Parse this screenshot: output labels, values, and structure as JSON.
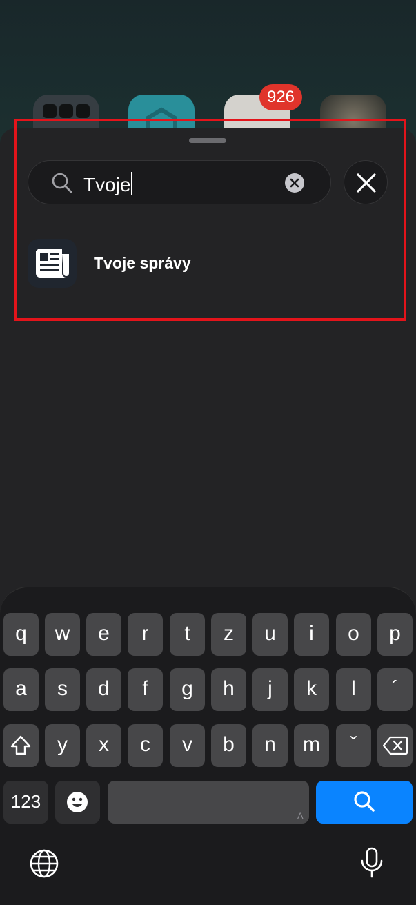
{
  "homescreen": {
    "badge_count": "926"
  },
  "search": {
    "query": "Tvoje",
    "clear_icon": "xmark-circle-icon",
    "close_icon": "xmark-icon"
  },
  "results": [
    {
      "label": "Tvoje správy",
      "icon": "newspaper-icon"
    }
  ],
  "keyboard": {
    "row1": [
      "q",
      "w",
      "e",
      "r",
      "t",
      "z",
      "u",
      "i",
      "o",
      "p"
    ],
    "row2": [
      "a",
      "s",
      "d",
      "f",
      "g",
      "h",
      "j",
      "k",
      "l",
      "´"
    ],
    "row3": [
      "y",
      "x",
      "c",
      "v",
      "b",
      "n",
      "m",
      "ˇ"
    ],
    "numbers_label": "123",
    "space_hint": "A",
    "search_key_color": "#0a84ff"
  }
}
